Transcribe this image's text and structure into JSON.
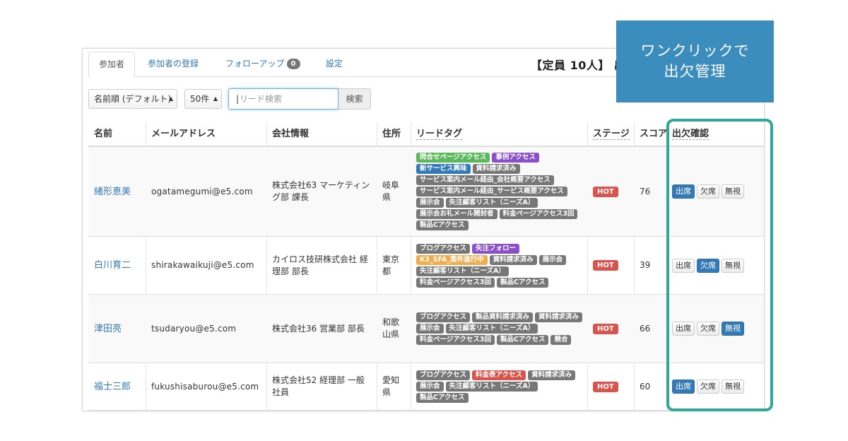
{
  "tabs": [
    {
      "label": "参加者"
    },
    {
      "label": "参加者の登録"
    },
    {
      "label": "フォローアップ",
      "badge": "0"
    },
    {
      "label": "設定"
    }
  ],
  "capacity_text": "【定員 10人】 出",
  "controls": {
    "sort_value": "名前順 (デフォルト)",
    "pagesize_value": "50件",
    "search_placeholder": "リード検索",
    "search_button": "検索"
  },
  "columns": [
    "名前",
    "メールアドレス",
    "会社情報",
    "住所",
    "リードタグ",
    "ステージ",
    "スコア",
    "出欠確認"
  ],
  "attendance_labels": [
    "出席",
    "欠席",
    "無視"
  ],
  "tag_colors": {
    "green": "#5cb85c",
    "purple": "#8a4fc9",
    "blue": "#337ab7",
    "gray": "#777777",
    "orange": "#f0ad4e",
    "red": "#d9534f"
  },
  "rows": [
    {
      "name": "緒形恵美",
      "email": "ogatamegumi@e5.com",
      "company": "株式会社63 マーケティング部 課長",
      "address": "岐阜県",
      "tags": [
        [
          "問合せページアクセス",
          "green"
        ],
        [
          "事例アクセス",
          "purple"
        ],
        [
          "新サービス興味",
          "blue"
        ],
        [
          "資料請求済み",
          "gray"
        ],
        [
          "サービス案内メール経由_会社概要アクセス",
          "gray"
        ],
        [
          "サービス案内メール経由_サービス概要アクセス",
          "gray"
        ],
        [
          "展示会",
          "gray"
        ],
        [
          "失注顧客リスト（ニーズA）",
          "gray"
        ],
        [
          "展示会お礼メール開封者",
          "gray"
        ],
        [
          "料金ページアクセス3回",
          "gray"
        ],
        [
          "製品Cアクセス",
          "gray"
        ]
      ],
      "stage": "HOT",
      "score": "76",
      "attendance": 0
    },
    {
      "name": "白川育二",
      "email": "shirakawaikuji@e5.com",
      "company": "カイロス技研株式会社 経理部 部長",
      "address": "東京都",
      "tags": [
        [
          "ブログアクセス",
          "gray"
        ],
        [
          "失注フォロー",
          "purple"
        ],
        [
          "K3_SFA_案件進行中",
          "orange"
        ],
        [
          "資料請求済み",
          "gray"
        ],
        [
          "展示会",
          "gray"
        ],
        [
          "失注顧客リスト（ニーズA）",
          "gray"
        ],
        [
          "料金ページアクセス3回",
          "gray"
        ],
        [
          "製品Cアクセス",
          "gray"
        ]
      ],
      "stage": "HOT",
      "score": "39",
      "attendance": 1
    },
    {
      "name": "津田亮",
      "email": "tsudaryou@e5.com",
      "company": "株式会社36 営業部 部長",
      "address": "和歌山県",
      "tags": [
        [
          "ブログアクセス",
          "gray"
        ],
        [
          "製品資料請求済み",
          "gray"
        ],
        [
          "資料請求済み",
          "gray"
        ],
        [
          "展示会",
          "gray"
        ],
        [
          "失注顧客リスト（ニーズA）",
          "gray"
        ],
        [
          "料金ページアクセス3回",
          "gray"
        ],
        [
          "製品Cアクセス",
          "gray"
        ],
        [
          "競合",
          "gray"
        ]
      ],
      "stage": "HOT",
      "score": "66",
      "attendance": 2
    },
    {
      "name": "福士三郎",
      "email": "fukushisaburou@e5.com",
      "company": "株式会社52 経理部 一般社員",
      "address": "愛知県",
      "tags": [
        [
          "ブログアクセス",
          "gray"
        ],
        [
          "料金表アクセス",
          "red"
        ],
        [
          "資料請求済み",
          "gray"
        ],
        [
          "展示会",
          "gray"
        ],
        [
          "失注顧客リスト（ニーズA）",
          "gray"
        ],
        [
          "製品Cアクセス",
          "gray"
        ]
      ],
      "stage": "HOT",
      "score": "60",
      "attendance": 0
    }
  ],
  "callout": {
    "line1": "ワンクリックで",
    "line2": "出欠管理"
  }
}
